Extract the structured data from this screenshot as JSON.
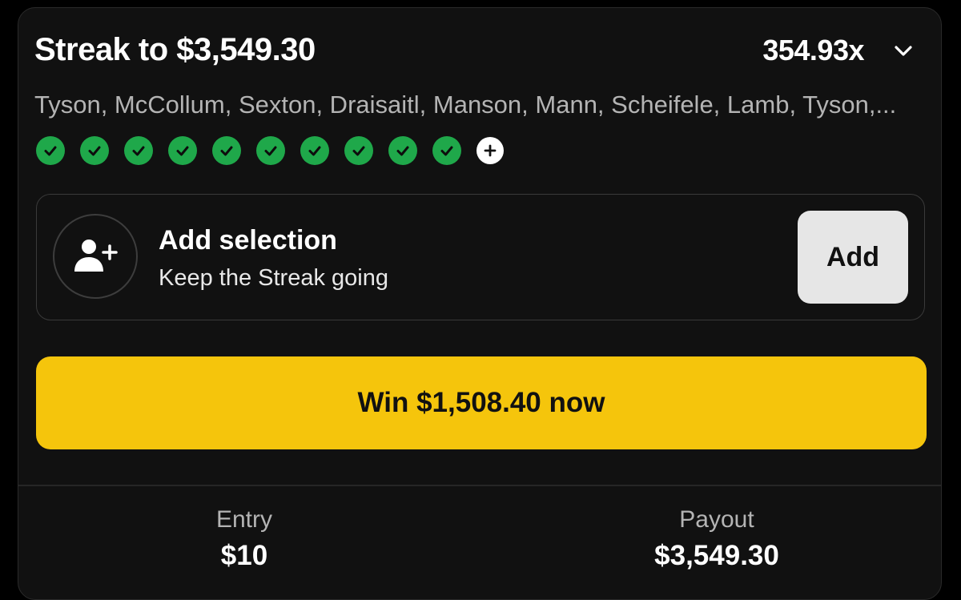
{
  "header": {
    "title": "Streak to $3,549.30",
    "multiplier": "354.93x",
    "chevron_icon": "chevron-down-icon"
  },
  "players_text": "Tyson, McCollum, Sexton, Draisaitl, Manson, Mann, Scheifele, Lamb, Tyson,...",
  "legs": {
    "completed_count": 10,
    "status": "won",
    "check_icon": "check-icon",
    "add_icon": "plus-icon"
  },
  "add_selection": {
    "title": "Add selection",
    "subtitle": "Keep the Streak going",
    "button_label": "Add",
    "icon": "add-user-icon"
  },
  "cashout_button_label": "Win $1,508.40 now",
  "footer": {
    "entry_label": "Entry",
    "entry_value": "$10",
    "payout_label": "Payout",
    "payout_value": "$3,549.30"
  },
  "colors": {
    "accent_yellow": "#f5c50c",
    "success_green": "#1fa84a",
    "card_background": "#111111"
  }
}
